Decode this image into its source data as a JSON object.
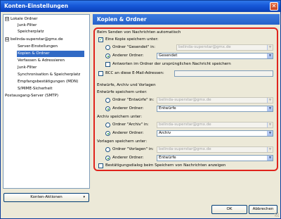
{
  "window": {
    "title": "Konten-Einstellungen",
    "close_glyph": "✕"
  },
  "tree": {
    "items": [
      {
        "label": "Lokale Ordner",
        "expander": "⊟"
      },
      {
        "label": "Junk-Filter"
      },
      {
        "label": "Speicherplatz"
      },
      {
        "label": "belinda-superstar@gmx.de",
        "expander": "⊟"
      },
      {
        "label": "Server-Einstellungen"
      },
      {
        "label": "Kopien & Ordner",
        "selected": true
      },
      {
        "label": "Verfassen & Adressieren"
      },
      {
        "label": "Junk-Filter"
      },
      {
        "label": "Synchronisation & Speicherplatz"
      },
      {
        "label": "Empfangsbestätigungen (MDN)"
      },
      {
        "label": "S/MIME-Sicherheit"
      },
      {
        "label": "Postausgang-Server (SMTP)"
      }
    ],
    "actions_button": "Konten-Aktionen",
    "actions_arrow": "▾"
  },
  "panel": {
    "title": "Kopien & Ordner",
    "sending_section": "Beim Senden von Nachrichten automatisch",
    "save_copy": {
      "label": "Eine Kopie speichern unter:",
      "checked": true,
      "check_glyph": "✓"
    },
    "sent_folder_option": {
      "label": "Ordner \"Gesendet\" in:",
      "value": "belinda-superstar@gmx.de"
    },
    "other_folder_option": {
      "label": "Anderer Ordner:",
      "value": "Gesendet"
    },
    "reply_in_folder": {
      "label": "Antworten im Ordner der ursprünglichen Nachricht speichern",
      "checked": false
    },
    "bcc": {
      "label": "BCC an diese E-Mail-Adressen:",
      "checked": false,
      "value": ""
    },
    "drafts_section": "Entwürfe, Archiv und Vorlagen",
    "drafts": {
      "heading": "Entwürfe speichern unter:",
      "folder_label": "Ordner \"Entwürfe\" in:",
      "folder_value": "belinda-superstar@gmx.de",
      "other_label": "Anderer Ordner:",
      "other_value": "Entwürfe"
    },
    "archive": {
      "heading": "Archiv speichern unter:",
      "folder_label": "Ordner \"Archiv\" in:",
      "folder_value": "belinda-superstar@gmx.de",
      "other_label": "Anderer Ordner:",
      "other_value": "Archiv"
    },
    "templates": {
      "heading": "Vorlagen speichern unter:",
      "folder_label": "Ordner \"Vorlagen\" in:",
      "folder_value": "belinda-superstar@gmx.de",
      "other_label": "Anderer Ordner:",
      "other_value": "Entwürfe"
    },
    "confirm_dialog": {
      "label": "Bestätigungsdialog beim Speichern von Nachrichten anzeigen",
      "checked": false
    },
    "dropdown_glyph": "▼"
  },
  "buttons": {
    "ok": "OK",
    "cancel": "Abbrechen"
  },
  "colors": {
    "highlight": "#e0231c",
    "selection": "#316ac5",
    "titlebar": "#1657d7"
  }
}
